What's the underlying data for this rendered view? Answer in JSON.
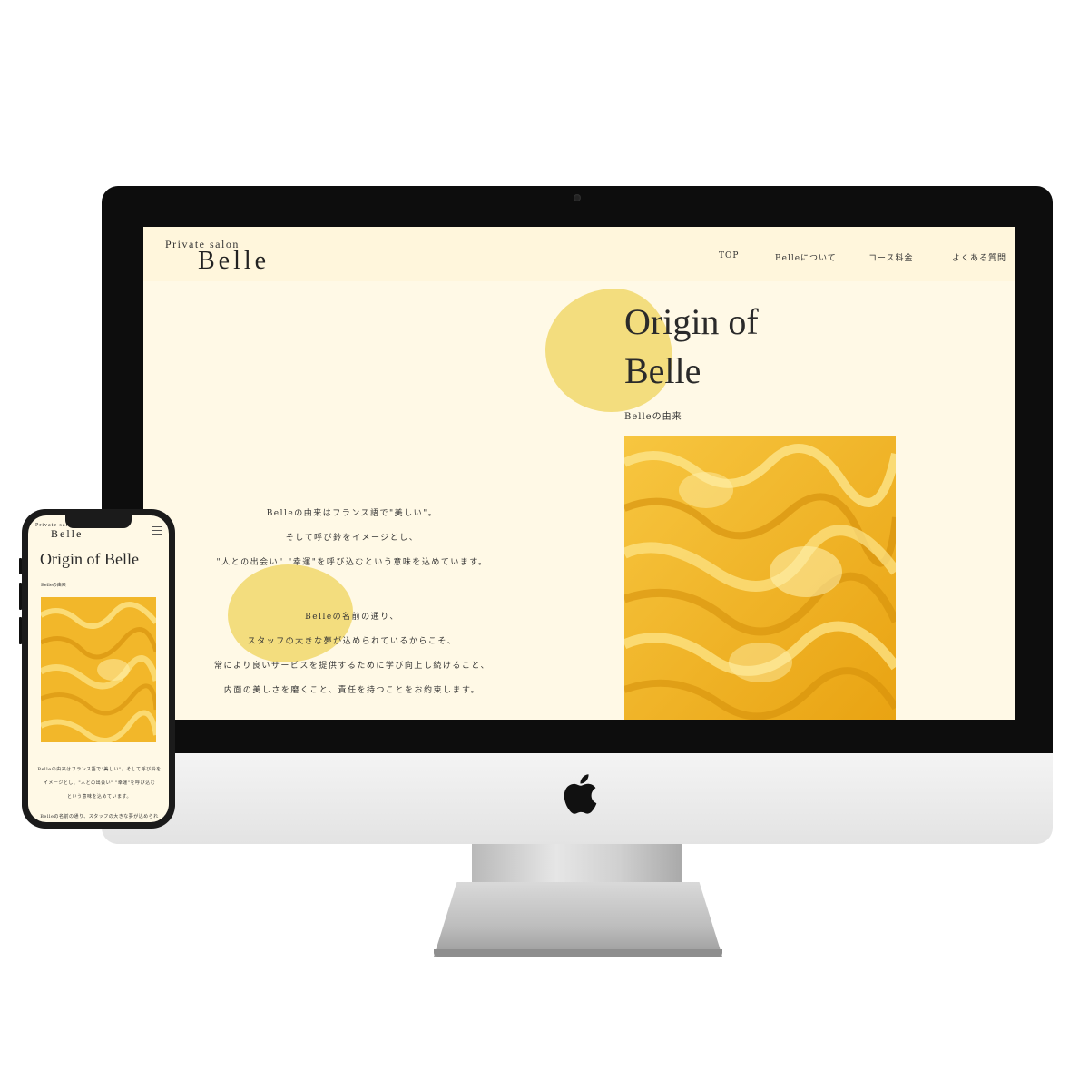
{
  "site": {
    "logo_top": "Private salon",
    "logo_main": "Belle"
  },
  "nav": [
    {
      "label": "TOP"
    },
    {
      "label": "Belleについて"
    },
    {
      "label": "コース料金"
    },
    {
      "label": "よくある質問"
    }
  ],
  "hero": {
    "title_line1": "Origin of",
    "title_line2": "Belle",
    "subtitle": "Belleの由来"
  },
  "body": {
    "p1_line1": "Belleの由来はフランス語で\"美しい\"。",
    "p1_line2": "そして呼び鈴をイメージとし、",
    "p1_line3": "\"人との出会い\" \"幸運\"を呼び込むという意味を込めています。",
    "p2_line1": "Belleの名前の通り、",
    "p2_line2": "スタッフの大きな夢が込められているからこそ、",
    "p2_line3": "常により良いサービスを提供するために学び向上し続けること、",
    "p2_line4": "内面の美しさを磨くこと、責任を持つことをお約束します。"
  },
  "mobile": {
    "logo_top": "Private salon",
    "logo_main": "Belle",
    "title": "Origin of Belle",
    "subtitle": "Belleの由来",
    "line1": "Belleの由来はフランス語で\"美しい\"。そして呼び鈴を",
    "line2": "イメージとし、\"人との出会い\" \"幸運\"を呼び込む",
    "line3": "という意味を込めています。",
    "line4": "Belleの名前の通り、スタッフの大きな夢が込められ"
  },
  "colors": {
    "screen_bg": "#fff9e6",
    "accent_blob": "#f3dd7e",
    "image_yellow": "#f5b823"
  },
  "icons": [
    "apple-logo-icon",
    "hamburger-menu-icon"
  ]
}
